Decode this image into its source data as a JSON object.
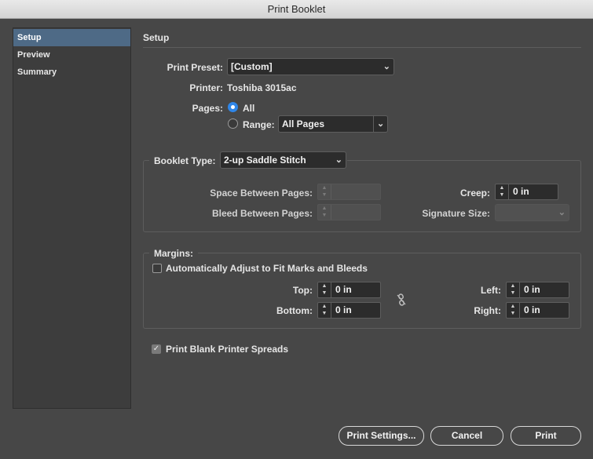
{
  "window": {
    "title": "Print Booklet"
  },
  "sidebar": {
    "items": [
      {
        "label": "Setup",
        "selected": true
      },
      {
        "label": "Preview",
        "selected": false
      },
      {
        "label": "Summary",
        "selected": false
      }
    ]
  },
  "setup": {
    "heading": "Setup",
    "print_preset_label": "Print Preset:",
    "print_preset_value": "[Custom]",
    "printer_label": "Printer:",
    "printer_value": "Toshiba 3015ac",
    "pages_label": "Pages:",
    "pages_all_label": "All",
    "pages_range_label": "Range:",
    "pages_range_value": "All Pages",
    "pages_selected": "All"
  },
  "booklet": {
    "type_label": "Booklet Type:",
    "type_value": "2-up Saddle Stitch",
    "space_between_label": "Space Between Pages:",
    "space_between_value": "",
    "bleed_between_label": "Bleed Between Pages:",
    "bleed_between_value": "",
    "creep_label": "Creep:",
    "creep_value": "0 in",
    "signature_label": "Signature Size:",
    "signature_value": ""
  },
  "margins": {
    "heading": "Margins:",
    "auto_adjust_label": "Automatically Adjust to Fit Marks and Bleeds",
    "auto_adjust_checked": false,
    "top_label": "Top:",
    "top_value": "0 in",
    "bottom_label": "Bottom:",
    "bottom_value": "0 in",
    "left_label": "Left:",
    "left_value": "0 in",
    "right_label": "Right:",
    "right_value": "0 in",
    "link_icon": "broken-link-icon"
  },
  "options": {
    "blank_spreads_label": "Print Blank Printer Spreads",
    "blank_spreads_checked": true
  },
  "buttons": {
    "print_settings": "Print Settings...",
    "cancel": "Cancel",
    "print": "Print"
  },
  "colors": {
    "background": "#474747",
    "selection": "#4e6a86",
    "radio_accent": "#2f86e8"
  }
}
